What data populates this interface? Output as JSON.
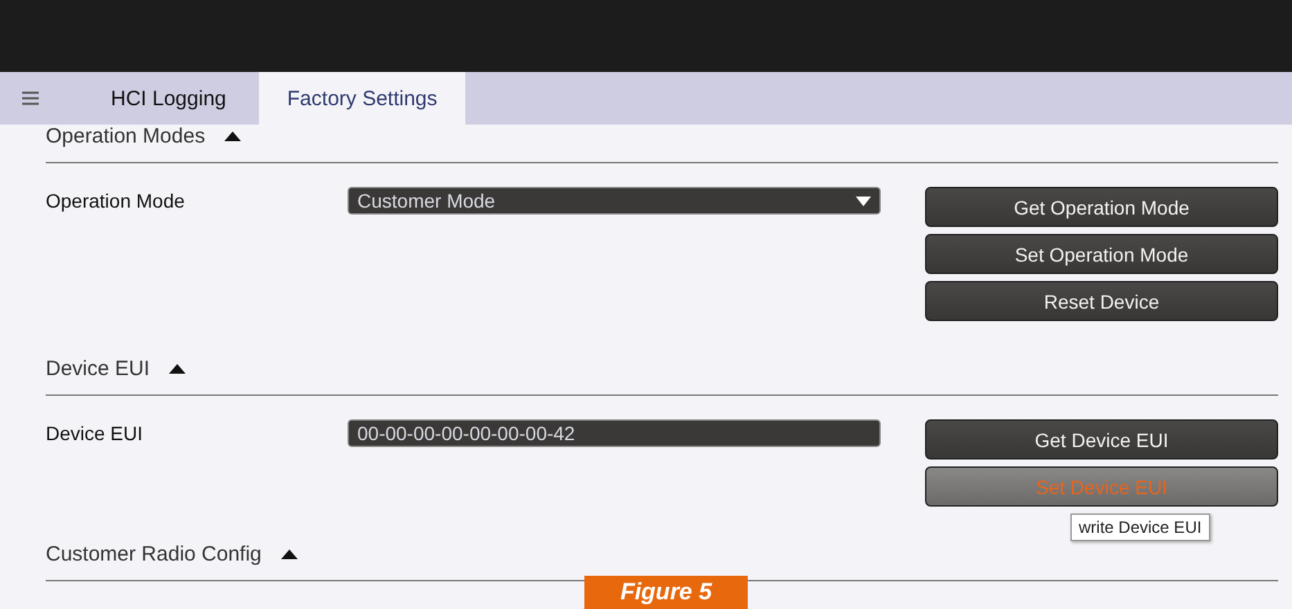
{
  "tabs": [
    {
      "label": "HCI Logging",
      "selected": false
    },
    {
      "label": "Factory Settings",
      "selected": true
    }
  ],
  "sections": [
    {
      "title": "Operation Modes",
      "expanded": true,
      "rows": [
        {
          "label": "Operation Mode",
          "field": {
            "kind": "dropdown",
            "value": "Customer Mode"
          },
          "buttons": [
            {
              "label": "Get Operation Mode",
              "hovered": false
            },
            {
              "label": "Set Operation Mode",
              "hovered": false
            },
            {
              "label": "Reset Device",
              "hovered": false
            }
          ]
        }
      ]
    },
    {
      "title": "Device EUI",
      "expanded": true,
      "rows": [
        {
          "label": "Device EUI",
          "field": {
            "kind": "text",
            "value": "00-00-00-00-00-00-00-42"
          },
          "buttons": [
            {
              "label": "Get Device EUI",
              "hovered": false
            },
            {
              "label": "Set Device EUI",
              "hovered": true,
              "tooltip": "write Device EUI"
            }
          ]
        }
      ]
    },
    {
      "title": "Customer Radio Config",
      "expanded": true
    }
  ],
  "figure_label": "Figure 5"
}
